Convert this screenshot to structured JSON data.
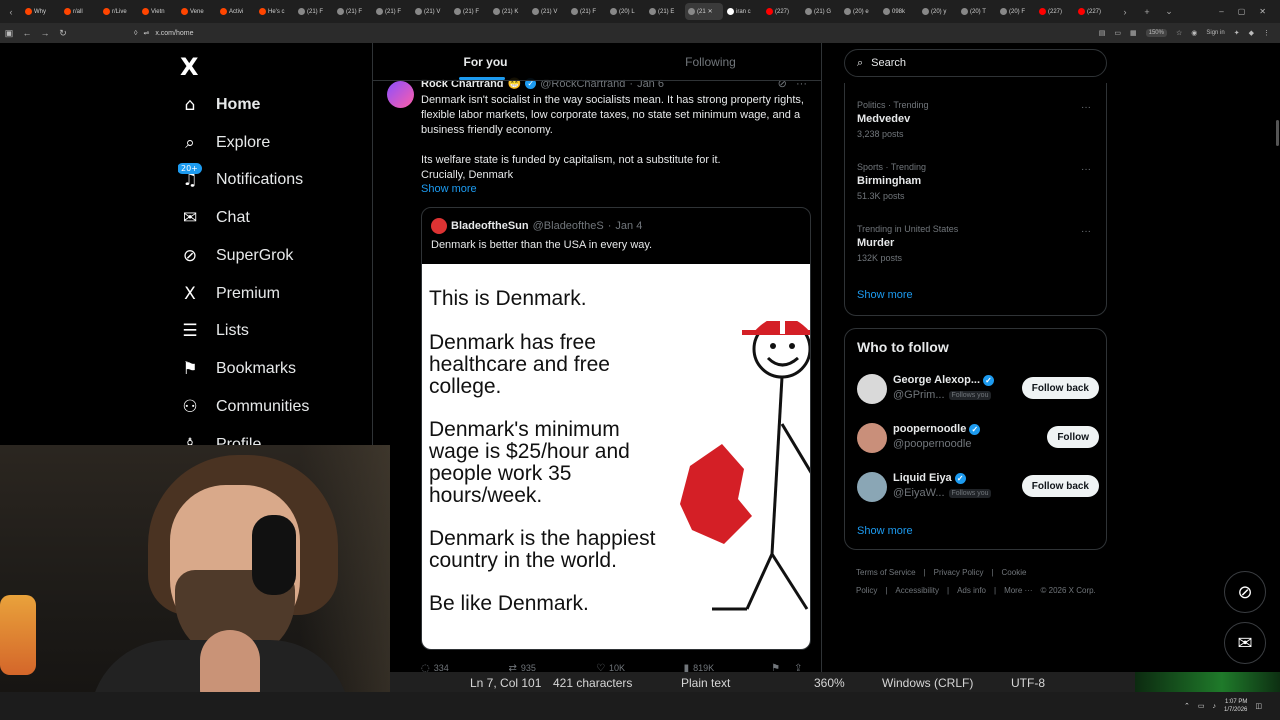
{
  "browser": {
    "tabs": [
      {
        "label": "Why",
        "color": "#ff4500"
      },
      {
        "label": "r/all",
        "color": "#ff4500"
      },
      {
        "label": "r/Live",
        "color": "#ff4500"
      },
      {
        "label": "Vietn",
        "color": "#ff4500"
      },
      {
        "label": "Vene",
        "color": "#ff4500"
      },
      {
        "label": "Activi",
        "color": "#ff4500"
      },
      {
        "label": "He's c",
        "color": "#ff4500"
      },
      {
        "label": "(21) F",
        "color": "#888888"
      },
      {
        "label": "(21) F",
        "color": "#888888"
      },
      {
        "label": "(21) F",
        "color": "#888888"
      },
      {
        "label": "(21) V",
        "color": "#888888"
      },
      {
        "label": "(21) F",
        "color": "#888888"
      },
      {
        "label": "(21) K",
        "color": "#888888"
      },
      {
        "label": "(21) V",
        "color": "#888888"
      },
      {
        "label": "(21) F",
        "color": "#888888"
      },
      {
        "label": "(20) L",
        "color": "#888888"
      },
      {
        "label": "(21) E",
        "color": "#888888"
      },
      {
        "label": "(21",
        "color": "#888888"
      },
      {
        "label": "iran c",
        "color": "#ffffff"
      },
      {
        "label": "(227)",
        "color": "#ff0000"
      },
      {
        "label": "(21) G",
        "color": "#888888"
      },
      {
        "label": "(20) e",
        "color": "#888888"
      },
      {
        "label": "098k",
        "color": "#888888"
      },
      {
        "label": "(20) y",
        "color": "#888888"
      },
      {
        "label": "(20) T",
        "color": "#888888"
      },
      {
        "label": "(20) F",
        "color": "#888888"
      },
      {
        "label": "(227)",
        "color": "#ff0000"
      },
      {
        "label": "(227)",
        "color": "#ff0000"
      }
    ],
    "active_tab_index": 17,
    "url": "x.com/home",
    "zoom": "150%",
    "signin_label": "Sign in"
  },
  "leftnav": {
    "logo": "X",
    "notifications_badge": "20+",
    "items": [
      {
        "label": "Home",
        "icon": "home-icon",
        "glyph": "⌂"
      },
      {
        "label": "Explore",
        "icon": "search-icon",
        "glyph": "⌕"
      },
      {
        "label": "Notifications",
        "icon": "bell-icon",
        "glyph": "♫"
      },
      {
        "label": "Chat",
        "icon": "mail-icon",
        "glyph": "✉"
      },
      {
        "label": "SuperGrok",
        "icon": "grok-icon",
        "glyph": "⊘"
      },
      {
        "label": "Premium",
        "icon": "x-icon",
        "glyph": "X"
      },
      {
        "label": "Lists",
        "icon": "list-icon",
        "glyph": "☰"
      },
      {
        "label": "Bookmarks",
        "icon": "bookmark-icon",
        "glyph": "⚑"
      },
      {
        "label": "Communities",
        "icon": "people-icon",
        "glyph": "⚇"
      },
      {
        "label": "Profile",
        "icon": "profile-icon",
        "glyph": "♙"
      }
    ]
  },
  "feed": {
    "tabs": [
      "For you",
      "Following"
    ],
    "post": {
      "author": "Rock Chartrand",
      "handle": "@RockChartrand",
      "date": "Jan 6",
      "body": [
        "Denmark isn't socialist in the way socialists mean. It has strong property rights, flexible labor markets, low corporate taxes, no state set minimum wage, and a business friendly economy.",
        "Its welfare state is funded by capitalism, not a substitute for it.",
        "Crucially, Denmark"
      ],
      "show_more": "Show more",
      "quote": {
        "author": "BladeoftheSun",
        "handle": "@BladeoftheS",
        "date": "Jan 4",
        "text": "Denmark is better than the USA in every way.",
        "image_lines": [
          "This is Denmark.",
          "Denmark has free",
          "healthcare and free",
          "college.",
          "Denmark's minimum",
          "wage is $25/hour and",
          "people work 35",
          "hours/week.",
          "Denmark is the happiest",
          "country in the world.",
          "Be like Denmark."
        ]
      },
      "actions": {
        "replies": "334",
        "reposts": "935",
        "likes": "10K",
        "views": "819K"
      }
    }
  },
  "sidebar": {
    "search_placeholder": "Search",
    "trends": [
      {
        "category": "Politics · Trending",
        "name": "Medvedev",
        "posts": "3,238 posts"
      },
      {
        "category": "Sports · Trending",
        "name": "Birmingham",
        "posts": "51.3K posts"
      },
      {
        "category": "Trending in United States",
        "name": "Murder",
        "posts": "132K posts"
      }
    ],
    "trends_show_more": "Show more",
    "who_to_follow": {
      "title": "Who to follow",
      "accounts": [
        {
          "name": "George Alexop...",
          "handle": "@GPrim...",
          "follows_you": "Follows you",
          "button": "Follow back",
          "avatar_color": "#d9d9d9"
        },
        {
          "name": "poopernoodle",
          "handle": "@poopernoodle",
          "follows_you": "",
          "button": "Follow",
          "avatar_color": "#c98f7a"
        },
        {
          "name": "Liquid Eiya",
          "handle": "@EiyaW...",
          "follows_you": "Follows you",
          "button": "Follow back",
          "avatar_color": "#8aa6b5"
        }
      ],
      "show_more": "Show more"
    },
    "footer": [
      "Terms of Service",
      "|",
      "Privacy Policy",
      "|",
      "Cookie Policy",
      "|",
      "Accessibility",
      "|",
      "Ads info",
      "|",
      "More ···",
      "© 2026 X Corp."
    ]
  },
  "notepad_status": {
    "position": "Ln 7, Col 101",
    "characters": "421 characters",
    "format": "Plain text",
    "zoom": "360%",
    "line_endings": "Windows (CRLF)",
    "encoding": "UTF-8"
  },
  "taskbar": {
    "time": "1:07 PM",
    "date": "1/7/2026"
  }
}
